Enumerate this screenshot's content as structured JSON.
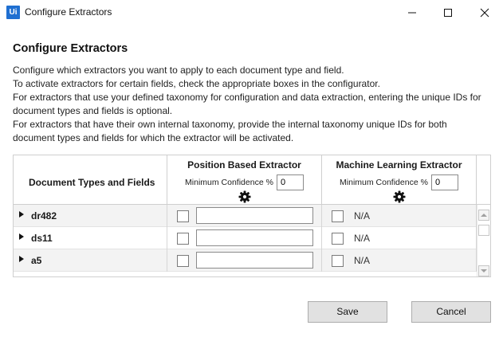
{
  "window": {
    "title": "Configure Extractors",
    "app_logo": "Ui"
  },
  "dialog": {
    "heading": "Configure Extractors",
    "description_lines": [
      "Configure which extractors you want to apply to each document type and field.",
      "To activate extractors for certain fields, check the appropriate boxes in the configurator.",
      "For extractors that use your defined taxonomy for configuration and data extraction, entering the unique IDs for",
      "document types and fields is optional.",
      "For extractors that have their own internal taxonomy, provide the internal taxonomy unique IDs for both",
      "document types and fields for which the extractor will be activated."
    ]
  },
  "grid": {
    "col0_header": "Document Types and Fields",
    "extractors": [
      {
        "name": "Position Based Extractor",
        "confidence_label": "Minimum Confidence %",
        "confidence_value": "0"
      },
      {
        "name": "Machine Learning Extractor",
        "confidence_label": "Minimum Confidence %",
        "confidence_value": "0"
      }
    ],
    "rows": [
      {
        "name": "dr482",
        "pbe_id": "",
        "mle_value": "N/A"
      },
      {
        "name": "ds11",
        "pbe_id": "",
        "mle_value": "N/A"
      },
      {
        "name": "a5",
        "pbe_id": "",
        "mle_value": "N/A"
      }
    ]
  },
  "footer": {
    "save_label": "Save",
    "cancel_label": "Cancel"
  },
  "icons": {
    "logo": "uipath-logo-icon",
    "minimize": "minimize-icon",
    "maximize": "maximize-icon",
    "close": "close-icon",
    "settings": "gear-icon",
    "expander": "expand-arrow-icon"
  },
  "colors": {
    "logo_blue": "#1f6fd1",
    "alt_row": "#f3f3f3",
    "button_bg": "#e1e1e1"
  }
}
